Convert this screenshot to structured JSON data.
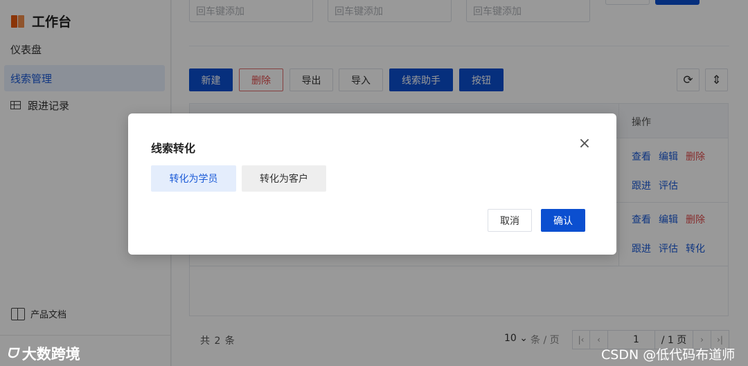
{
  "sidebar": {
    "title": "工作台",
    "items": [
      {
        "label": "仪表盘"
      },
      {
        "label": "线索管理"
      },
      {
        "label": "跟进记录"
      }
    ],
    "docs_label": "产品文档"
  },
  "filters": {
    "placeholders": [
      "回车键添加",
      "回车键添加",
      "回车键添加"
    ]
  },
  "toolbar": {
    "new": "新建",
    "delete": "删除",
    "export": "导出",
    "import": "导入",
    "assistant": "线索助手",
    "button": "按钮",
    "refresh_icon": "refresh-icon",
    "column_height_icon": "vertical-align-icon"
  },
  "table": {
    "op_header": "操作",
    "rows": [
      {
        "view": "查看",
        "edit": "编辑",
        "delete": "删除",
        "follow": "跟进",
        "evaluate": "评估"
      },
      {
        "view": "查看",
        "edit": "编辑",
        "delete": "删除",
        "follow": "跟进",
        "evaluate": "评估",
        "convert": "转化"
      }
    ]
  },
  "pagination": {
    "total_text": "共 2 条",
    "page_size": "10",
    "page_size_unit": "条 / 页",
    "current_page": "1",
    "total_pages": "/ 1 页"
  },
  "modal": {
    "title": "线索转化",
    "option_student": "转化为学员",
    "option_customer": "转化为客户",
    "cancel": "取消",
    "confirm": "确认"
  },
  "watermarks": {
    "left": "大数跨境",
    "right": "CSDN @低代码布道师"
  },
  "colors": {
    "primary": "#0b4fd0",
    "danger": "#e04b4b",
    "link": "#1c5bd7"
  }
}
